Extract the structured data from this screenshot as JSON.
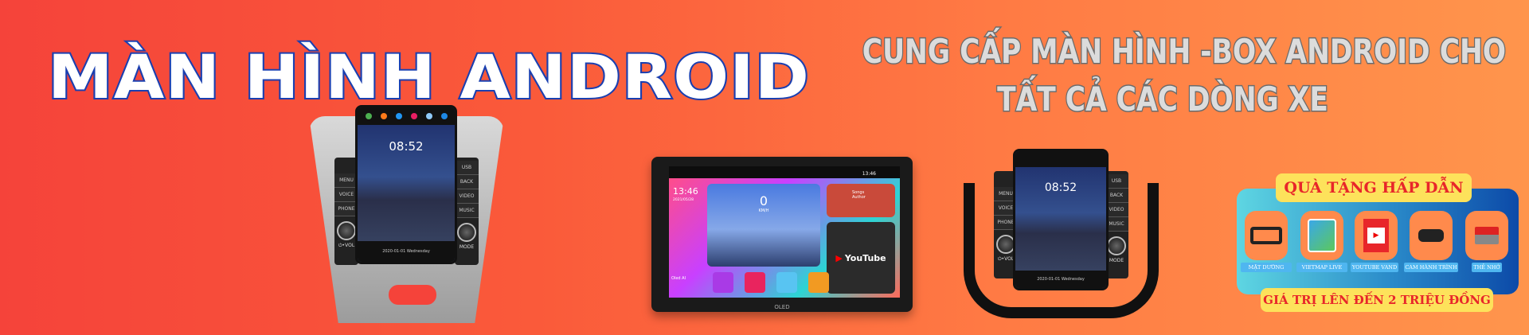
{
  "title": "MÀN HÌNH ANDROID",
  "headline": {
    "line1": "CUNG CẤP MÀN HÌNH -BOX ANDROID CHO",
    "line2": "TẤT CẢ CÁC DÒNG XE"
  },
  "left_device": {
    "time": "08:52",
    "date": "2020-01-01  Wednesday",
    "buttons_left": [
      "MENU",
      "VOICE",
      "PHONE"
    ],
    "buttons_right": [
      "USB",
      "BACK",
      "VIDEO",
      "MUSIC"
    ],
    "knob_left": "⏻•VOL",
    "knob_right": "MODE"
  },
  "center_device": {
    "clock": "13:46",
    "date": "2021/05/28",
    "status_time": "13:46",
    "speed": "0",
    "speed_unit": "KM/H",
    "song": "Songs",
    "author": "Author",
    "youtube": "YouTube",
    "assistant": "Oled AI",
    "brand": "OLED"
  },
  "right_device": {
    "time": "08:52",
    "date": "2020-01-01  Wednesday",
    "buttons_left": [
      "MENU",
      "VOICE",
      "PHONE"
    ],
    "buttons_right": [
      "USB",
      "BACK",
      "VIDEO",
      "MUSIC"
    ],
    "knob_left": "⏻•VOL",
    "knob_right": "MODE"
  },
  "gifts": {
    "header": "QUÀ TẶNG HẤP DẪN",
    "items": [
      {
        "label": "MẶT DƯỠNG",
        "icon": "dash-frame"
      },
      {
        "label": "VIETMAP LIVE",
        "icon": "map-app"
      },
      {
        "label": "YOUTUBE VAND",
        "icon": "youtube-premium"
      },
      {
        "label": "CAM HÀNH TRÌNH",
        "icon": "dashcam"
      },
      {
        "label": "THẺ NHỚ",
        "icon": "sd-card"
      }
    ],
    "footer": "GIÁ TRỊ LÊN ĐẾN 2 TRIỆU ĐỒNG"
  },
  "colors": {
    "bg_left": "#f5433a",
    "bg_right": "#ff954c",
    "title_stroke": "#1a3fb0",
    "gift_yellow": "#fde25b",
    "gift_text": "#e8262a"
  }
}
